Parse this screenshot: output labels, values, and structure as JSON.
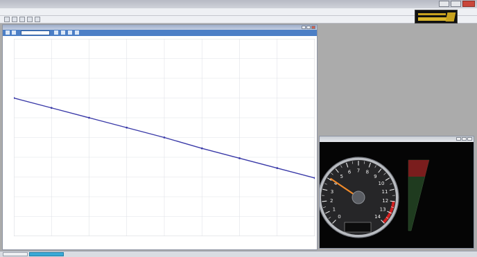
{
  "window": {
    "title": ""
  },
  "menu": {
    "items": [
      "",
      "",
      "",
      "",
      "",
      ""
    ]
  },
  "toolbar": {
    "icons": [
      "new-file-icon",
      "open-folder-icon",
      "save-icon",
      "print-icon",
      "settings-icon"
    ]
  },
  "chart_window": {
    "title": "",
    "status_segments": [
      "",
      "",
      "",
      "",
      ""
    ]
  },
  "chart_data": {
    "type": "line",
    "title": "",
    "xlabel": "",
    "ylabel": "",
    "xlim": [
      0,
      8
    ],
    "ylim": [
      0,
      10
    ],
    "x": [
      0,
      1,
      2,
      3,
      4,
      5,
      6,
      7,
      8
    ],
    "series": [
      {
        "values": [
          7.0,
          6.5,
          6.0,
          5.5,
          5.0,
          4.45,
          3.95,
          3.45,
          2.95
        ],
        "color": "#3a3aa8"
      }
    ],
    "grid": true
  },
  "gauge": {
    "ticks": [
      "0",
      "1",
      "2",
      "3",
      "4",
      "5",
      "6",
      "7",
      "8",
      "9",
      "10",
      "11",
      "12",
      "13",
      "14"
    ],
    "needle_value": 4.1,
    "max_value": 14,
    "brand": "",
    "readout": "",
    "bar_top_label": "",
    "bar_mid_label": "",
    "bar_bottom_label": "",
    "right_top": "",
    "right_top_sub": "",
    "right_mid": "",
    "right_mid_value": "",
    "right_low": "",
    "right_low_value": "",
    "gear_value": ""
  },
  "colors": {
    "accent": "#4c7fc6",
    "line": "#3a3aa8",
    "needle": "#f08a2a",
    "redline": "#d21f1f"
  },
  "taskbar": {
    "tabs": [
      "",
      ""
    ]
  }
}
